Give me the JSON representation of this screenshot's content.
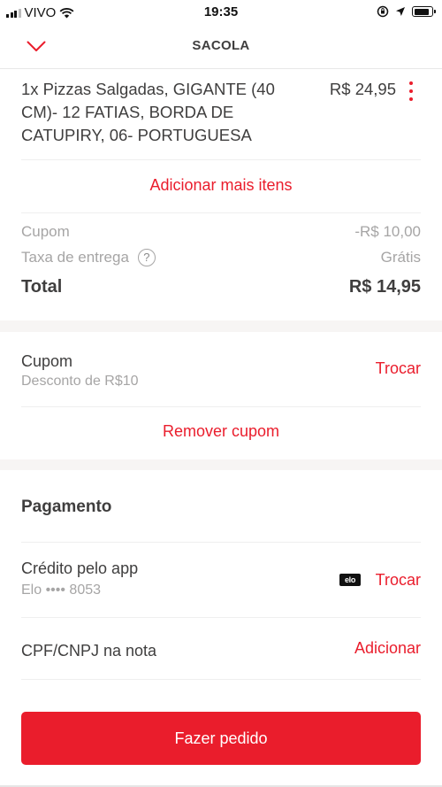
{
  "status_bar": {
    "carrier": "VIVO",
    "time": "19:35",
    "icons": [
      "signal-icon",
      "wifi-icon",
      "orientation-lock-icon",
      "location-arrow-icon",
      "battery-icon"
    ],
    "battery_level": 0.85
  },
  "header": {
    "title": "SACOLA",
    "back_icon": "chevron-down-icon"
  },
  "cart": {
    "items": [
      {
        "description": "1x Pizzas Salgadas, GIGANTE (40 CM)- 12 FATIAS, BORDA DE CATUPIRY, 06- PORTUGUESA",
        "price": "R$  24,95",
        "menu_icon": "more-vertical-icon"
      }
    ],
    "add_more_label": "Adicionar mais itens"
  },
  "summary": {
    "coupon_label": "Cupom",
    "coupon_value": "-R$  10,00",
    "delivery_label": "Taxa de entrega",
    "delivery_help": "?",
    "delivery_value": "Grátis",
    "total_label": "Total",
    "total_value": "R$  14,95"
  },
  "coupon": {
    "title": "Cupom",
    "subtitle": "Desconto de R$10",
    "change_label": "Trocar",
    "remove_label": "Remover cupom"
  },
  "payment": {
    "section_title": "Pagamento",
    "method_title": "Crédito pelo app",
    "card_info": "Elo •••• 8053",
    "card_brand": "elo",
    "change_label": "Trocar"
  },
  "invoice": {
    "label": "CPF/CNPJ na nota",
    "add_label": "Adicionar"
  },
  "checkout": {
    "button_label": "Fazer pedido"
  },
  "colors": {
    "accent": "#ea1d2c",
    "text": "#3f3e3e",
    "muted": "#a6a5a5",
    "band": "#f7f5f4"
  }
}
